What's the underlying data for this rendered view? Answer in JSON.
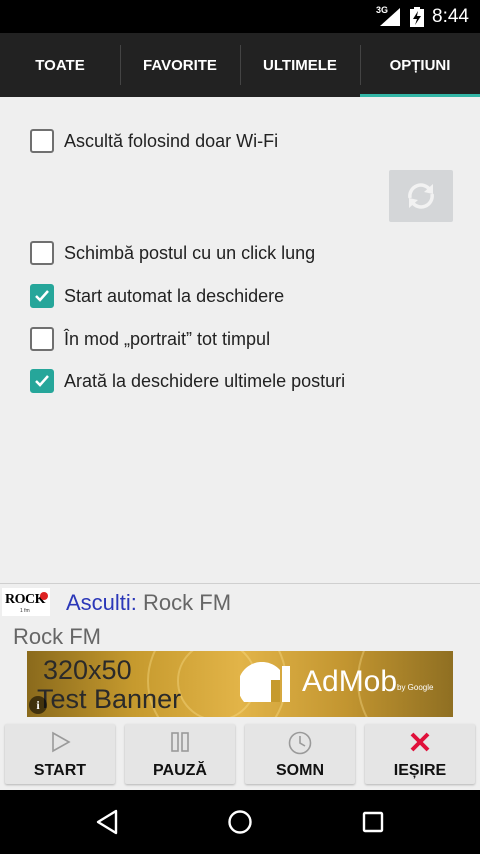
{
  "status_bar": {
    "network": "3G",
    "time": "8:44"
  },
  "tabs": [
    {
      "label": "TOATE"
    },
    {
      "label": "FAVORITE"
    },
    {
      "label": "ULTIMELE"
    },
    {
      "label": "OPȚIUNI",
      "active": true
    }
  ],
  "options": [
    {
      "label": "Ascultă folosind doar Wi-Fi",
      "checked": false
    },
    {
      "label": "Schimbă postul cu un click lung",
      "checked": false
    },
    {
      "label": "Start automat la deschidere",
      "checked": true
    },
    {
      "label": "În mod „portrait” tot timpul",
      "checked": false
    },
    {
      "label": "Arată la deschidere ultimele posturi",
      "checked": true
    }
  ],
  "refresh_icon": "refresh-icon",
  "now_playing": {
    "logo_text": "ROCK",
    "logo_sub": "1 fm",
    "label": "Asculti:",
    "station": "Rock FM",
    "subtitle": "Rock FM"
  },
  "ad": {
    "line1": "320x50",
    "line2": "Test Banner",
    "brand": "AdMob",
    "by": "by Google",
    "info": "i"
  },
  "controls": [
    {
      "label": "START",
      "icon": "play-icon"
    },
    {
      "label": "PAUZĂ",
      "icon": "pause-icon"
    },
    {
      "label": "SOMN",
      "icon": "clock-icon"
    },
    {
      "label": "IEȘIRE",
      "icon": "close-icon"
    }
  ],
  "colors": {
    "accent": "#26a69a",
    "tab_indicator": "#33b6a6",
    "now_playing_label": "#2b37b8",
    "exit_icon": "#e0103a"
  }
}
